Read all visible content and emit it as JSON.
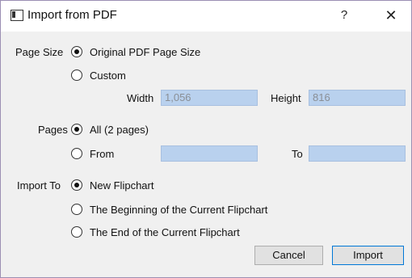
{
  "window": {
    "title": "Import from PDF",
    "help_label": "?",
    "close_label": "✕"
  },
  "page_size": {
    "label": "Page Size",
    "options": [
      {
        "label": "Original PDF Page Size",
        "selected": true
      },
      {
        "label": "Custom",
        "selected": false
      }
    ],
    "width_label": "Width",
    "width_value": "1,056",
    "height_label": "Height",
    "height_value": "816"
  },
  "pages": {
    "label": "Pages",
    "options": [
      {
        "label": "All (2 pages)",
        "selected": true
      },
      {
        "label": "From",
        "selected": false
      }
    ],
    "from_value": "",
    "to_label": "To",
    "to_value": ""
  },
  "import_to": {
    "label": "Import To",
    "options": [
      {
        "label": "New Flipchart",
        "selected": true
      },
      {
        "label": "The Beginning of the Current Flipchart",
        "selected": false
      },
      {
        "label": "The End of the Current Flipchart",
        "selected": false
      }
    ]
  },
  "buttons": {
    "cancel": "Cancel",
    "import": "Import"
  },
  "colors": {
    "field_fill": "#b9d1ee",
    "dialog_bg": "#f0f0f0",
    "default_button_border": "#0078d7"
  }
}
